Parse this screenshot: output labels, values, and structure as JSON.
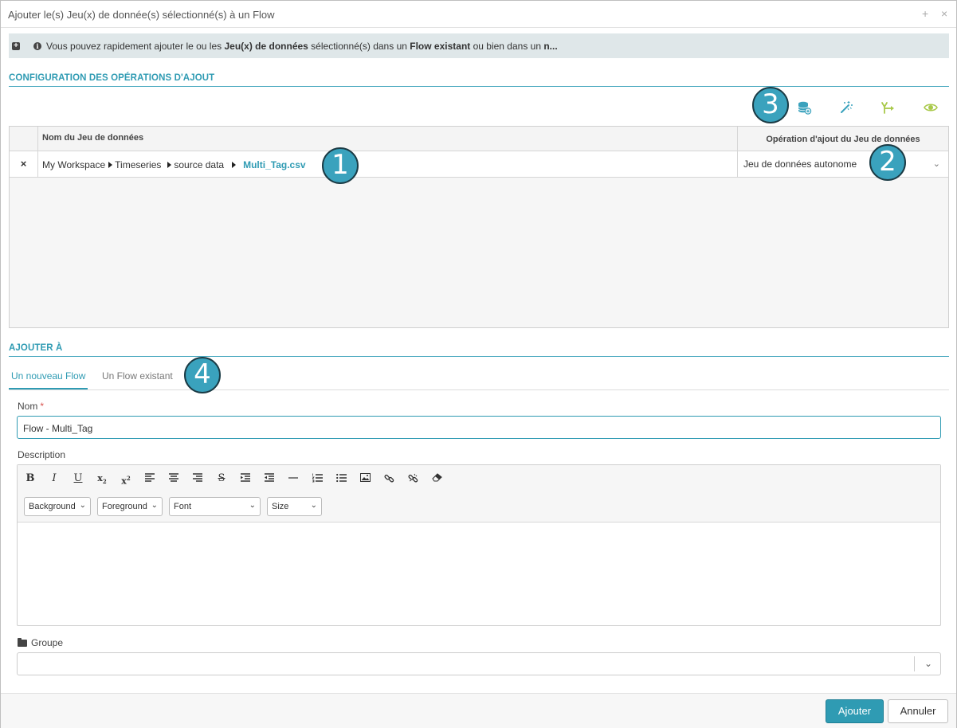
{
  "dialog": {
    "title": "Ajouter le(s) Jeu(x) de donnée(s) sélectionné(s) à un Flow",
    "maximize_glyph": "+",
    "close_glyph": "×"
  },
  "info": {
    "text_1": "Vous pouvez rapidement ajouter le ou les ",
    "bold_1": "Jeu(x) de données",
    "text_2": " sélectionné(s) dans un ",
    "bold_2": "Flow existant",
    "text_3": " ou bien dans un ",
    "bold_3": "n..."
  },
  "config_section": {
    "title": "CONFIGURATION DES OPÉRATIONS D'AJOUT",
    "tools": [
      "database-add-icon",
      "magic-wand-icon",
      "merge-arrow-icon",
      "eye-toggle-icon"
    ],
    "accent": "#2f9bb3",
    "tool_color_blue": "#3aa2bd",
    "tool_color_green": "#a9c94a"
  },
  "grid": {
    "col_name": "Nom du Jeu de données",
    "col_operation": "Opération d'ajout du Jeu de données",
    "rows": [
      {
        "remove": "×",
        "path": [
          "My Workspace",
          "Timeseries",
          "source data"
        ],
        "file": "Multi_Tag.csv",
        "operation": "Jeu de données autonome"
      }
    ]
  },
  "badges": {
    "one": "1",
    "two": "2",
    "three": "3",
    "four": "4"
  },
  "add_to": {
    "title": "AJOUTER À",
    "tab_new": "Un nouveau Flow",
    "tab_existing": "Un Flow existant"
  },
  "form": {
    "name_label": "Nom",
    "required_mark": "*",
    "name_value": "Flow - Multi_Tag",
    "description_label": "Description",
    "selects": {
      "background": "Background",
      "foreground": "Foreground",
      "font": "Font",
      "size": "Size"
    },
    "group_label": "Groupe",
    "group_value": ""
  },
  "buttons": {
    "add": "Ajouter",
    "cancel": "Annuler"
  }
}
